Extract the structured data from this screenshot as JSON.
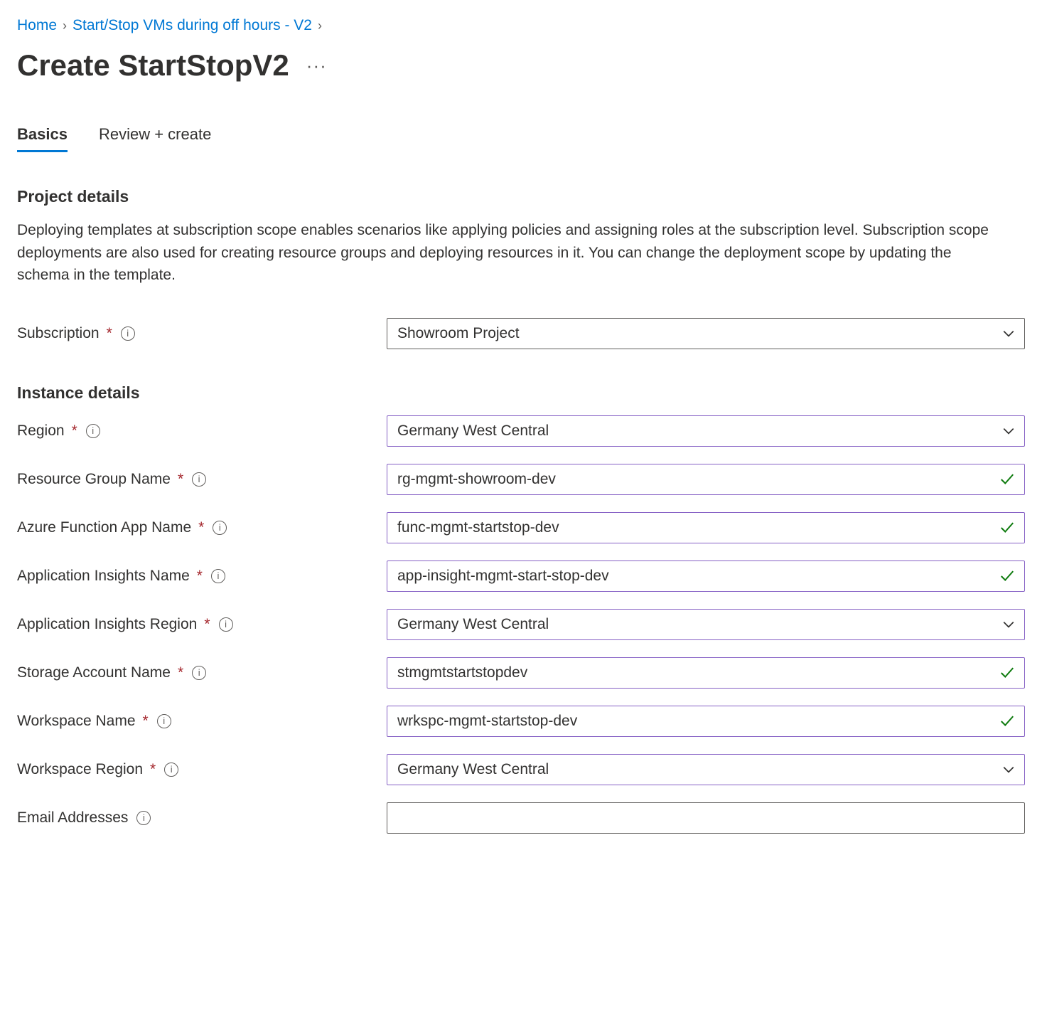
{
  "breadcrumb": {
    "home": "Home",
    "parent": "Start/Stop VMs during off hours - V2"
  },
  "page_title": "Create StartStopV2",
  "tabs": {
    "basics": "Basics",
    "review": "Review + create"
  },
  "sections": {
    "project": {
      "title": "Project details",
      "description": "Deploying templates at subscription scope enables scenarios like applying policies and assigning roles at the subscription level. Subscription scope deployments are also used for creating resource groups and deploying resources in it. You can change the deployment scope by updating the schema in the template."
    },
    "instance": {
      "title": "Instance details"
    }
  },
  "fields": {
    "subscription": {
      "label": "Subscription",
      "value": "Showroom Project"
    },
    "region": {
      "label": "Region",
      "value": "Germany West Central"
    },
    "resource_group": {
      "label": "Resource Group Name",
      "value": "rg-mgmt-showroom-dev"
    },
    "function_app": {
      "label": "Azure Function App Name",
      "value": "func-mgmt-startstop-dev"
    },
    "app_insights": {
      "label": "Application Insights Name",
      "value": "app-insight-mgmt-start-stop-dev"
    },
    "app_insights_region": {
      "label": "Application Insights Region",
      "value": "Germany West Central"
    },
    "storage_account": {
      "label": "Storage Account Name",
      "value": "stmgmtstartstopdev"
    },
    "workspace_name": {
      "label": "Workspace Name",
      "value": "wrkspc-mgmt-startstop-dev"
    },
    "workspace_region": {
      "label": "Workspace Region",
      "value": "Germany West Central"
    },
    "email": {
      "label": "Email Addresses",
      "value": ""
    }
  }
}
